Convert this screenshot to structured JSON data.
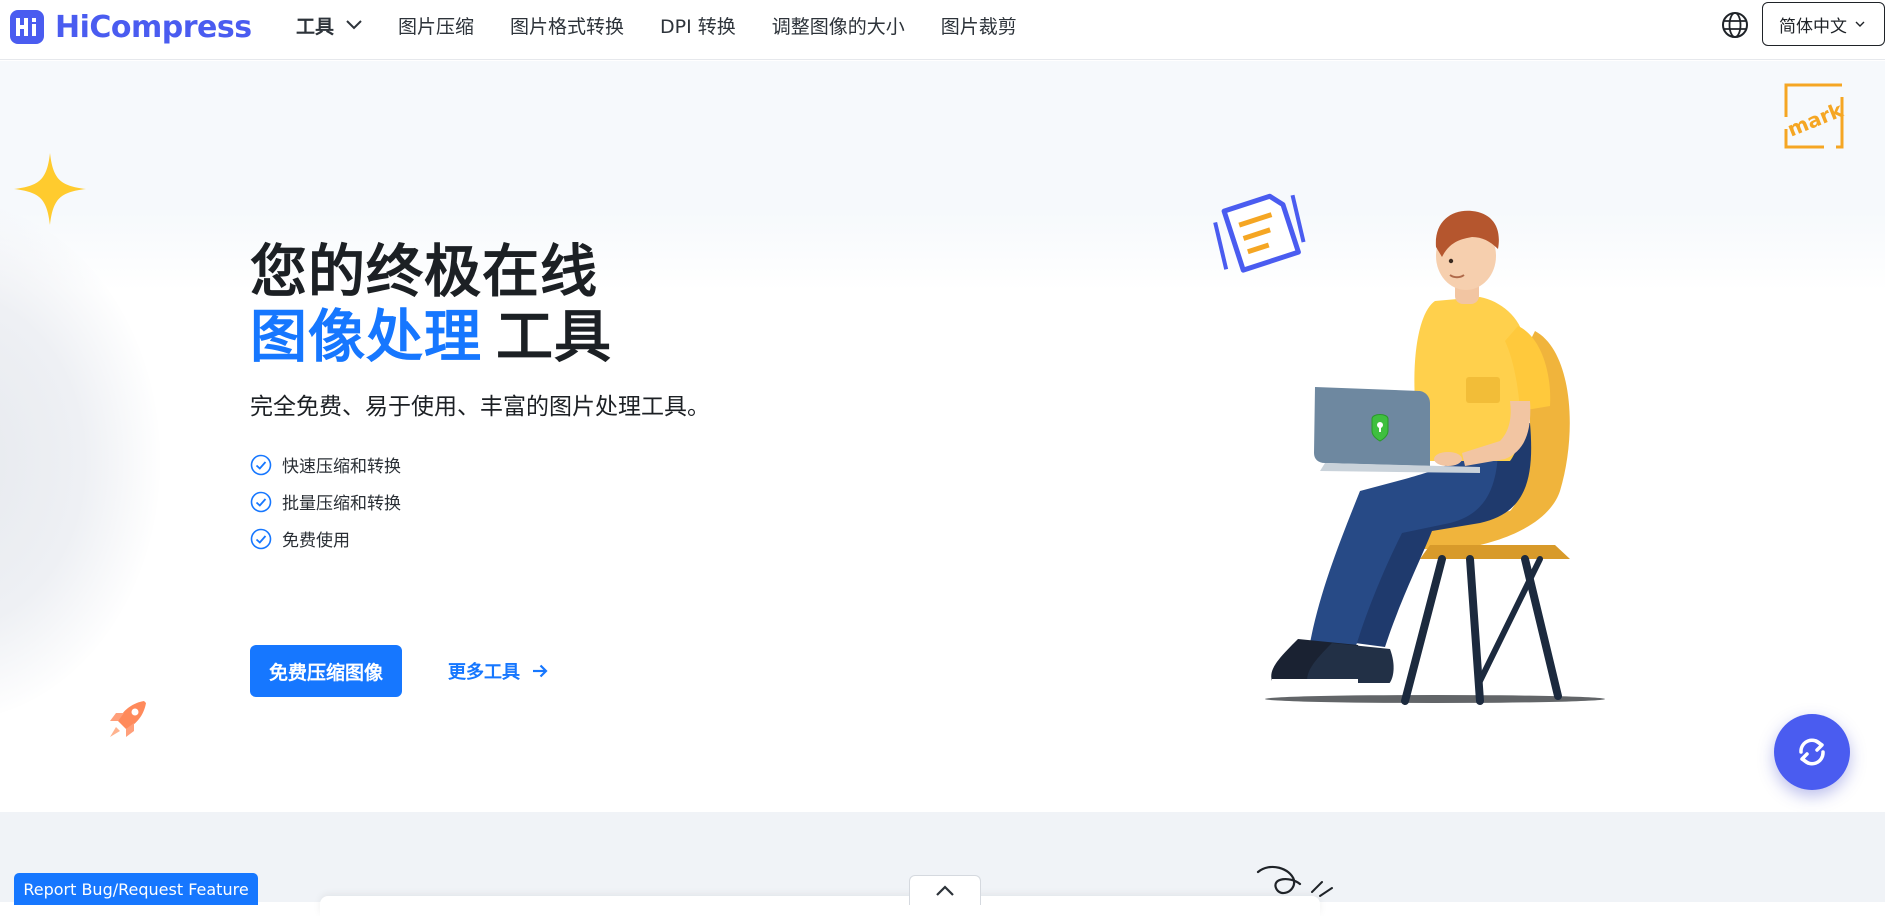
{
  "brand": {
    "name": "HiCompress",
    "color": "#4a5cf0",
    "icon": "hi-logo-icon"
  },
  "nav": {
    "items": [
      {
        "label": "工具",
        "has_dropdown": true
      },
      {
        "label": "图片压缩"
      },
      {
        "label": "图片格式转换"
      },
      {
        "label": "DPI 转换"
      },
      {
        "label": "调整图像的大小"
      },
      {
        "label": "图片裁剪"
      }
    ],
    "globe_icon": "globe-icon",
    "language": "简体中文"
  },
  "hero": {
    "title_line1": "您的终极在线",
    "title_accent": "图像处理",
    "title_rest": "工具",
    "subtitle": "完全免费、易于使用、丰富的图片处理工具。",
    "features": [
      "快速压缩和转换",
      "批量压缩和转换",
      "免费使用"
    ],
    "cta_label": "免费压缩图像",
    "more_label": "更多工具",
    "accent_color": "#1677ff",
    "badge_text": "mark"
  },
  "footer": {
    "report_label": "Report Bug/Request Feature"
  }
}
